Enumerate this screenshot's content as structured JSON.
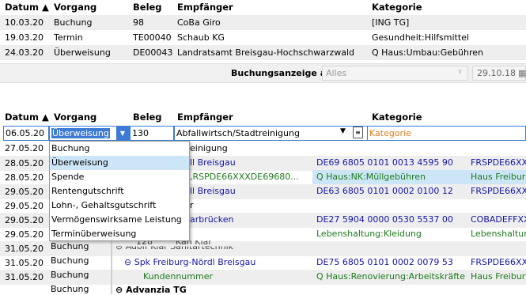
{
  "top_table": {
    "headers": {
      "datum": "Datum",
      "vorgang": "Vorgang",
      "beleg": "Beleg",
      "empfaenger": "Empfänger",
      "kategorie": "Kategorie"
    },
    "rows": [
      {
        "datum": "10.03.20",
        "vorgang": "Buchung",
        "beleg": "98",
        "empfaenger": "CoBa Giro",
        "kategorie": "[ING TG]"
      },
      {
        "datum": "19.03.20",
        "vorgang": "Termin",
        "beleg": "TE00040",
        "empfaenger": "Schaub KG",
        "kategorie": "Gesundheit:Hilfsmittel"
      },
      {
        "datum": "24.03.20",
        "vorgang": "Überweisung",
        "beleg": "DE00043",
        "empfaenger": "Landratsamt Breisgau-Hochschwarzwald",
        "kategorie": "Q Haus:Umbau:Gebühren"
      }
    ]
  },
  "control_bar": {
    "label": "Buchungsanzeige ab",
    "filter_value": "Alles",
    "date_value": "29.10.18"
  },
  "bottom_table": {
    "headers": {
      "datum": "Datum",
      "vorgang": "Vorgang",
      "beleg": "Beleg",
      "empfaenger": "Empfänger",
      "kategorie": "Kategorie"
    },
    "edit_row": {
      "datum": "06.05.20",
      "vorgang": "Überweisung",
      "beleg": "130",
      "empfaenger": "Abfallwirtsch/Stadtreinigung",
      "kategorie_placeholder": "Kategorie"
    },
    "dates": [
      "27.05.20",
      "28.05.20",
      "28.05.20",
      "29.05.20",
      "29.05.20",
      "29.05.20",
      "29.05.20",
      "31.05.20",
      "31.05.20",
      "31.05.20"
    ],
    "vorgang_visible": {
      "row7": "Buchung",
      "row8": "Buchung",
      "row9": "Buchung",
      "row10": "Buchung"
    },
    "beleg_partial": {
      "row7": "128"
    },
    "empf_partial": {
      "r1": "einigung",
      "r2": "ll Breisgau",
      "r3": ",RSPDE66XXXDE69680...",
      "r4": "ll Breisgau",
      "r5": "r",
      "r6": "arbrücken",
      "r7": "Adolf Klar Sanitärtechnik",
      "r7_b": "Kan Klar",
      "r8": "Spk Freiburg-Nördl Breisgau",
      "r9": "Kundennummer",
      "r10": "Advanzia TG"
    },
    "iban": {
      "r2": "DE69 6805 0101 0013 4595 90",
      "r3": "Q Haus:NK:Müllgebühren",
      "r4": "DE63 6805 0101 0002 0100 12",
      "r6": "DE27 5904 0000 0530 5537 00",
      "r7": "Lebenshaltung:Kleidung",
      "r8": "DE75 6805 0101 0002 0079 53",
      "r9": "Q Haus:Renovierung:Arbeitskräfte"
    },
    "bic": {
      "r2": "FRSPDE66XX",
      "r3": "Haus Freibur",
      "r4": "FRSPDE66XX",
      "r6": "COBADEFFXX",
      "r7": "Lebenshaltur",
      "r8": "FRSPDE66XX",
      "r9": "Haus Freibur"
    }
  },
  "dropdown": {
    "options": [
      "Buchung",
      "Überweisung",
      "Spende",
      "Rentengutschrift",
      "Lohn-, Gehaltsgutschrift",
      "Vermögenswirksame Leistung",
      "Terminüberweisung"
    ],
    "selected_index": 1
  },
  "sort_glyph": "▲",
  "collapse_glyph": "⊖",
  "colors": {
    "link_blue": "#1515a8",
    "green": "#1c7a1c",
    "orange": "#e08020",
    "selection": "#cde6f7"
  }
}
